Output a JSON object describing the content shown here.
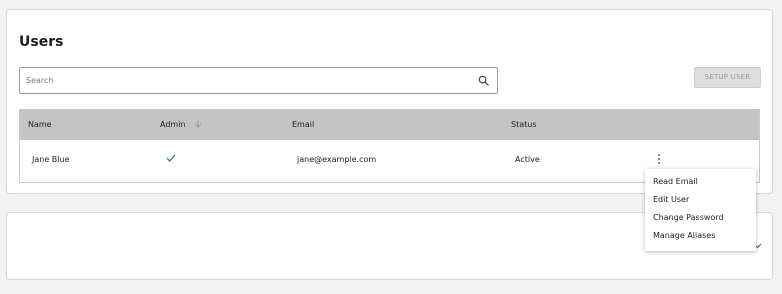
{
  "users_panel": {
    "title": "Users",
    "search": {
      "placeholder": "Search",
      "value": ""
    },
    "setup_button_label": "SETUP USER",
    "table": {
      "columns": [
        "Name",
        "Admin",
        "Email",
        "Status"
      ],
      "sorted_column": "Admin",
      "rows": [
        {
          "name": "Jane Blue",
          "admin": true,
          "email": "jane@example.com",
          "status": "Active"
        }
      ]
    },
    "row_menu": {
      "items": [
        "Read Email",
        "Edit User",
        "Change Password",
        "Manage Aliases"
      ]
    }
  },
  "colors": {
    "header_bg": "#c4c4c4",
    "check": "#2e8b57",
    "kebab": "#2a6fdb",
    "disabled_button": "#dedede"
  }
}
